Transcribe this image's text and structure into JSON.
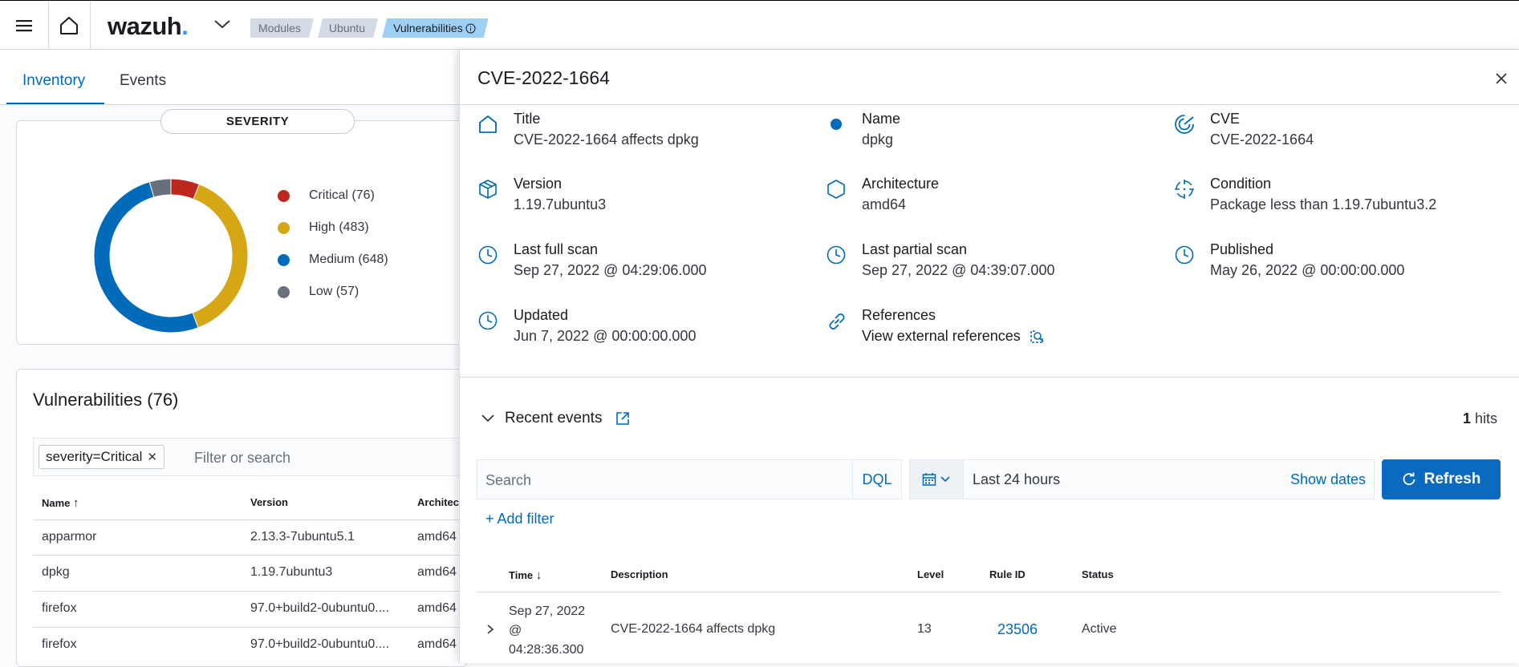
{
  "header": {
    "logo_text": "wazuh",
    "logo_dot": ".",
    "breadcrumbs": [
      "Modules",
      "Ubuntu",
      "Vulnerabilities"
    ]
  },
  "left": {
    "tabs": [
      "Inventory",
      "Events"
    ],
    "severity_title": "SEVERITY",
    "severity": [
      {
        "label": "Critical (76)",
        "value": 76,
        "color": "#bd271e"
      },
      {
        "label": "High (483)",
        "value": 483,
        "color": "#d6a715"
      },
      {
        "label": "Medium (648)",
        "value": 648,
        "color": "#006bb8"
      },
      {
        "label": "Low (57)",
        "value": 57,
        "color": "#69707d"
      }
    ],
    "vulnerabilities_title": "Vulnerabilities (76)",
    "filter_chip": "severity=Critical",
    "filter_placeholder": "Filter or search",
    "columns": [
      "Name",
      "Version",
      "Architecture"
    ],
    "columns_visible": [
      "Name",
      "Version",
      "Architec"
    ],
    "rows": [
      {
        "name": "apparmor",
        "version": "2.13.3-7ubuntu5.1",
        "arch": "amd64"
      },
      {
        "name": "dpkg",
        "version": "1.19.7ubuntu3",
        "arch": "amd64"
      },
      {
        "name": "firefox",
        "version": "97.0+build2-0ubuntu0....",
        "arch": "amd64"
      },
      {
        "name": "firefox",
        "version": "97.0+build2-0ubuntu0....",
        "arch": "amd64"
      }
    ]
  },
  "flyout": {
    "title": "CVE-2022-1664",
    "details": {
      "title": {
        "label": "Title",
        "value": "CVE-2022-1664 affects dpkg"
      },
      "name": {
        "label": "Name",
        "value": "dpkg"
      },
      "cve": {
        "label": "CVE",
        "value": "CVE-2022-1664"
      },
      "version": {
        "label": "Version",
        "value": "1.19.7ubuntu3"
      },
      "architecture": {
        "label": "Architecture",
        "value": "amd64"
      },
      "condition": {
        "label": "Condition",
        "value": "Package less than 1.19.7ubuntu3.2"
      },
      "last_full_scan": {
        "label": "Last full scan",
        "value": "Sep 27, 2022 @ 04:29:06.000"
      },
      "last_partial_scan": {
        "label": "Last partial scan",
        "value": "Sep 27, 2022 @ 04:39:07.000"
      },
      "published": {
        "label": "Published",
        "value": "May 26, 2022 @ 00:00:00.000"
      },
      "updated": {
        "label": "Updated",
        "value": "Jun 7, 2022 @ 00:00:00.000"
      },
      "references": {
        "label": "References",
        "value": "View external references"
      }
    },
    "recent_events_label": "Recent events",
    "hits_count": "1",
    "hits_label": "hits",
    "search_placeholder": "Search",
    "dql_label": "DQL",
    "date_range": "Last 24 hours",
    "show_dates": "Show dates",
    "refresh_label": "Refresh",
    "add_filter": "+ Add filter",
    "event_columns": [
      "Time",
      "Description",
      "Level",
      "Rule ID",
      "Status"
    ],
    "events": [
      {
        "time_lines": [
          "Sep 27, 2022",
          "@",
          "04:28:36.300"
        ],
        "description": "CVE-2022-1664 affects dpkg",
        "level": "13",
        "rule_id": "23506",
        "status": "Active"
      }
    ]
  },
  "colors": {
    "accent": "#006bb8",
    "refresh_bg": "#0a6ac0",
    "breadcrumb_active": "#9ed0f5"
  }
}
